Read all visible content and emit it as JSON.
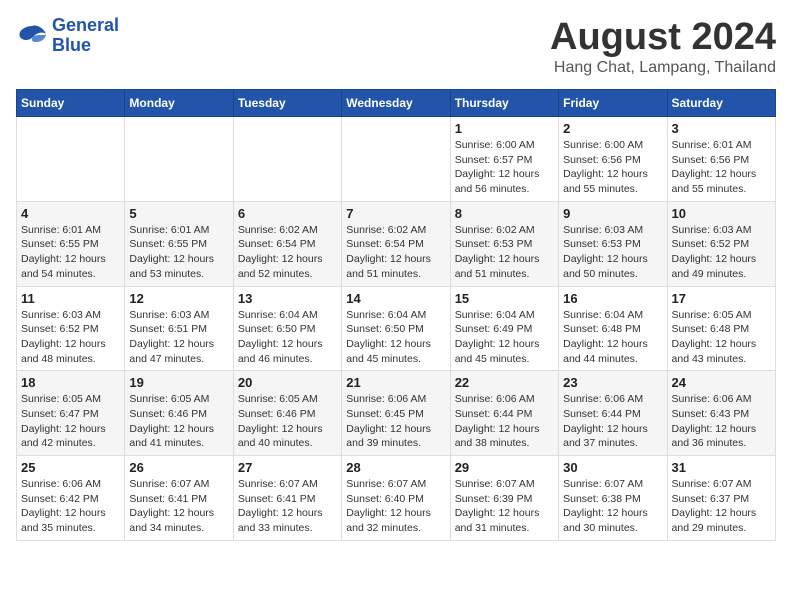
{
  "logo": {
    "line1": "General",
    "line2": "Blue"
  },
  "title": "August 2024",
  "subtitle": "Hang Chat, Lampang, Thailand",
  "days": [
    "Sunday",
    "Monday",
    "Tuesday",
    "Wednesday",
    "Thursday",
    "Friday",
    "Saturday"
  ],
  "weeks": [
    [
      {
        "date": "",
        "info": ""
      },
      {
        "date": "",
        "info": ""
      },
      {
        "date": "",
        "info": ""
      },
      {
        "date": "",
        "info": ""
      },
      {
        "date": "1",
        "info": "Sunrise: 6:00 AM\nSunset: 6:57 PM\nDaylight: 12 hours\nand 56 minutes."
      },
      {
        "date": "2",
        "info": "Sunrise: 6:00 AM\nSunset: 6:56 PM\nDaylight: 12 hours\nand 55 minutes."
      },
      {
        "date": "3",
        "info": "Sunrise: 6:01 AM\nSunset: 6:56 PM\nDaylight: 12 hours\nand 55 minutes."
      }
    ],
    [
      {
        "date": "4",
        "info": "Sunrise: 6:01 AM\nSunset: 6:55 PM\nDaylight: 12 hours\nand 54 minutes."
      },
      {
        "date": "5",
        "info": "Sunrise: 6:01 AM\nSunset: 6:55 PM\nDaylight: 12 hours\nand 53 minutes."
      },
      {
        "date": "6",
        "info": "Sunrise: 6:02 AM\nSunset: 6:54 PM\nDaylight: 12 hours\nand 52 minutes."
      },
      {
        "date": "7",
        "info": "Sunrise: 6:02 AM\nSunset: 6:54 PM\nDaylight: 12 hours\nand 51 minutes."
      },
      {
        "date": "8",
        "info": "Sunrise: 6:02 AM\nSunset: 6:53 PM\nDaylight: 12 hours\nand 51 minutes."
      },
      {
        "date": "9",
        "info": "Sunrise: 6:03 AM\nSunset: 6:53 PM\nDaylight: 12 hours\nand 50 minutes."
      },
      {
        "date": "10",
        "info": "Sunrise: 6:03 AM\nSunset: 6:52 PM\nDaylight: 12 hours\nand 49 minutes."
      }
    ],
    [
      {
        "date": "11",
        "info": "Sunrise: 6:03 AM\nSunset: 6:52 PM\nDaylight: 12 hours\nand 48 minutes."
      },
      {
        "date": "12",
        "info": "Sunrise: 6:03 AM\nSunset: 6:51 PM\nDaylight: 12 hours\nand 47 minutes."
      },
      {
        "date": "13",
        "info": "Sunrise: 6:04 AM\nSunset: 6:50 PM\nDaylight: 12 hours\nand 46 minutes."
      },
      {
        "date": "14",
        "info": "Sunrise: 6:04 AM\nSunset: 6:50 PM\nDaylight: 12 hours\nand 45 minutes."
      },
      {
        "date": "15",
        "info": "Sunrise: 6:04 AM\nSunset: 6:49 PM\nDaylight: 12 hours\nand 45 minutes."
      },
      {
        "date": "16",
        "info": "Sunrise: 6:04 AM\nSunset: 6:48 PM\nDaylight: 12 hours\nand 44 minutes."
      },
      {
        "date": "17",
        "info": "Sunrise: 6:05 AM\nSunset: 6:48 PM\nDaylight: 12 hours\nand 43 minutes."
      }
    ],
    [
      {
        "date": "18",
        "info": "Sunrise: 6:05 AM\nSunset: 6:47 PM\nDaylight: 12 hours\nand 42 minutes."
      },
      {
        "date": "19",
        "info": "Sunrise: 6:05 AM\nSunset: 6:46 PM\nDaylight: 12 hours\nand 41 minutes."
      },
      {
        "date": "20",
        "info": "Sunrise: 6:05 AM\nSunset: 6:46 PM\nDaylight: 12 hours\nand 40 minutes."
      },
      {
        "date": "21",
        "info": "Sunrise: 6:06 AM\nSunset: 6:45 PM\nDaylight: 12 hours\nand 39 minutes."
      },
      {
        "date": "22",
        "info": "Sunrise: 6:06 AM\nSunset: 6:44 PM\nDaylight: 12 hours\nand 38 minutes."
      },
      {
        "date": "23",
        "info": "Sunrise: 6:06 AM\nSunset: 6:44 PM\nDaylight: 12 hours\nand 37 minutes."
      },
      {
        "date": "24",
        "info": "Sunrise: 6:06 AM\nSunset: 6:43 PM\nDaylight: 12 hours\nand 36 minutes."
      }
    ],
    [
      {
        "date": "25",
        "info": "Sunrise: 6:06 AM\nSunset: 6:42 PM\nDaylight: 12 hours\nand 35 minutes."
      },
      {
        "date": "26",
        "info": "Sunrise: 6:07 AM\nSunset: 6:41 PM\nDaylight: 12 hours\nand 34 minutes."
      },
      {
        "date": "27",
        "info": "Sunrise: 6:07 AM\nSunset: 6:41 PM\nDaylight: 12 hours\nand 33 minutes."
      },
      {
        "date": "28",
        "info": "Sunrise: 6:07 AM\nSunset: 6:40 PM\nDaylight: 12 hours\nand 32 minutes."
      },
      {
        "date": "29",
        "info": "Sunrise: 6:07 AM\nSunset: 6:39 PM\nDaylight: 12 hours\nand 31 minutes."
      },
      {
        "date": "30",
        "info": "Sunrise: 6:07 AM\nSunset: 6:38 PM\nDaylight: 12 hours\nand 30 minutes."
      },
      {
        "date": "31",
        "info": "Sunrise: 6:07 AM\nSunset: 6:37 PM\nDaylight: 12 hours\nand 29 minutes."
      }
    ]
  ]
}
